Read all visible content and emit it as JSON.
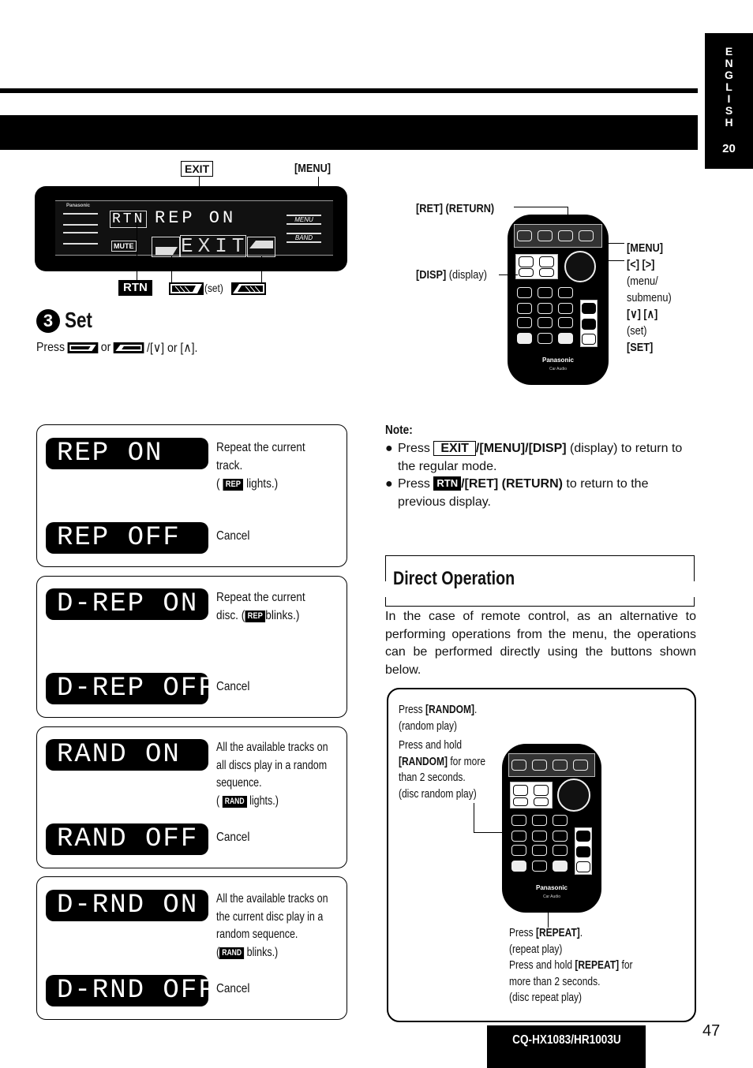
{
  "language_tab": {
    "letters": [
      "E",
      "N",
      "G",
      "L",
      "I",
      "S",
      "H"
    ],
    "number": "20"
  },
  "head_unit": {
    "exit_label": "EXIT",
    "menu_label": "[MENU]",
    "brand": "Panasonic",
    "display_rtn": "RTN",
    "display_text": "REP ON",
    "display_exit": "EXIT",
    "mute_label": "MUTE",
    "menu_button": "MENU",
    "band_button": "BAND",
    "rtn_badge": "RTN",
    "set_text": "(set)"
  },
  "step": {
    "number": "3",
    "title": "Set",
    "press": "Press",
    "or1": "or",
    "rest": "/[∨] or [∧]."
  },
  "remote_top": {
    "ret_label": "[RET] (RETURN)",
    "disp_label_bold": "[DISP]",
    "disp_label": "(display)",
    "right_labels": [
      "[MENU]",
      "[<] [>]",
      "(menu/",
      "submenu)",
      "[∨] [∧]",
      "(set)",
      "[SET]"
    ],
    "brand": "Panasonic",
    "sub": "Car Audio"
  },
  "options": [
    {
      "on_display": "REP  ON",
      "on_desc": [
        "Repeat the current",
        "track."
      ],
      "badge_prefix": "(",
      "badge": "REP",
      "badge_suffix": "lights.)",
      "off_display": "REP  OFF",
      "off_desc": "Cancel"
    },
    {
      "on_display": "D-REP ON",
      "on_desc": [
        "Repeat the current",
        "disc. ("
      ],
      "badge": "REP",
      "badge_suffix": "blinks.)",
      "off_display": "D-REP OFF",
      "off_desc": "Cancel"
    },
    {
      "on_display": "RAND  ON",
      "on_desc": [
        "All the available tracks on",
        "all discs play in a random",
        "sequence."
      ],
      "badge_prefix": "(",
      "badge": "RAND",
      "badge_suffix": "lights.)",
      "off_display": "RAND  OFF",
      "off_desc": "Cancel"
    },
    {
      "on_display": "D-RND ON",
      "on_desc": [
        "All the available tracks on",
        "the current disc play in a",
        "random sequence."
      ],
      "badge_prefix": "(",
      "badge": "RAND",
      "badge_suffix": "blinks.)",
      "off_display": "D-RND OFF",
      "off_desc": "Cancel"
    }
  ],
  "note": {
    "title": "Note:",
    "items": [
      {
        "press": "Press",
        "exit": "EXIT",
        "rest_bold": "/[MENU]/[DISP]",
        "rest": " (display) to return to the regular mode."
      },
      {
        "press": "Press",
        "rtn": "RTN",
        "rest_bold": "/[RET] (RETURN)",
        "rest": " to return to the previous display."
      }
    ]
  },
  "direct_operation": {
    "title": "Direct Operation",
    "body": "In the case of remote control, as an alternative to performing operations from the menu, the operations can be performed directly using the buttons shown below.",
    "random_press": {
      "prefix": "Press ",
      "key": "[RANDOM]",
      "suffix": ".",
      "note": "(random play)"
    },
    "random_hold": {
      "l1": "Press and hold",
      "key": "[RANDOM]",
      "l2": " for more",
      "l3": "than 2 seconds.",
      "note": "(disc random play)"
    },
    "repeat_press": {
      "prefix": "Press ",
      "key": "[REPEAT]",
      "suffix": ".",
      "note": "(repeat play)"
    },
    "repeat_hold": {
      "prefix": "Press and hold ",
      "key": "[REPEAT]",
      "suffix": " for",
      "l2": "more than 2 seconds.",
      "note": "(disc repeat play)"
    },
    "remote_brand": "Panasonic",
    "remote_sub": "Car Audio"
  },
  "footer": {
    "model": "CQ-HX1083/HR1003U",
    "page": "47"
  }
}
